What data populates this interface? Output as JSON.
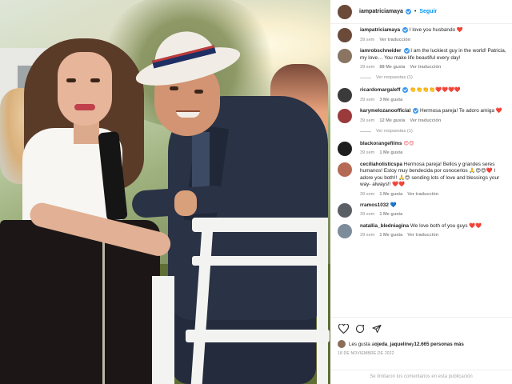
{
  "post": {
    "author": "iampatriciamaya",
    "follow_label": "Seguir",
    "separator": "•",
    "photo_alt": "couple at outdoor event"
  },
  "comments": [
    {
      "user": "iampatriciamaya",
      "verified": true,
      "avatar_color": "#6b4a3a",
      "text": "I love you husbando",
      "heart": "❤️",
      "time": "39 sem",
      "likes": "",
      "translate": "Ver traducción",
      "replies": ""
    },
    {
      "user": "iamrobschneider",
      "verified": true,
      "avatar_color": "#8a7563",
      "text": "I am the luckiest guy in the world! Patricia, my love… You make life beautiful every day!",
      "heart": "",
      "time": "39 sem",
      "likes": "88 Me gusta",
      "translate": "Ver traducción",
      "replies": "Ver respuestas (1)"
    },
    {
      "user": "ricardomargaleff",
      "verified": true,
      "avatar_color": "#3a3a3a",
      "text": "",
      "emojis": "👏👏👏👏❤️❤️❤️❤️",
      "time": "39 sem",
      "likes": "3 Me gusta",
      "translate": "",
      "replies": ""
    },
    {
      "user": "karymelozanoofficial",
      "verified": true,
      "avatar_color": "#9b3a3a",
      "text": "Hermosa pareja! Te adoro amiga",
      "heart": "❤️",
      "time": "39 sem",
      "likes": "12 Me gusta",
      "translate": "Ver traducción",
      "replies": "Ver respuestas (1)"
    },
    {
      "user": "blackorangefilms",
      "verified": false,
      "avatar_color": "#1e1e1e",
      "text": "",
      "emojis": "😍😍",
      "time": "39 sem",
      "likes": "1 Me gusta",
      "translate": "",
      "replies": ""
    },
    {
      "user": "ceciliaholisticspa",
      "verified": false,
      "avatar_color": "#b56a56",
      "text": "Hermosa pareja! Bellos y grandes seres humanos! Estoy muy bendecida por conocerlos 🙏😍😍❤️ I adore you both!! 🙏😍 sending lots of love and blessings your way- always!! ❤️❤️",
      "heart": "",
      "time": "39 sem",
      "likes": "1 Me gusta",
      "translate": "Ver traducción",
      "replies": ""
    },
    {
      "user": "rramos1032",
      "verified": false,
      "avatar_color": "#5a5f66",
      "text": "",
      "emojis": "💙",
      "time": "39 sem",
      "likes": "1 Me gusta",
      "translate": "",
      "replies": ""
    },
    {
      "user": "natallia_bledniagina",
      "verified": false,
      "avatar_color": "#7d8c9a",
      "text": "We love both of you guys",
      "heart": "❤️❤️",
      "time": "39 sem",
      "likes": "1 Me gusta",
      "translate": "Ver traducción",
      "replies": ""
    }
  ],
  "actions": {
    "like_icon": "heart-outline-icon",
    "comment_icon": "comment-icon",
    "share_icon": "paper-plane-icon"
  },
  "likes": {
    "prefix": "Les gusta a ",
    "user": "ojeda_jaqueline",
    "middle": " y ",
    "count": "12.665 personas más"
  },
  "date": "18 DE NOVIEMBRE DE 2022",
  "comments_disabled": "Se limitaron los comentarios en esta publicación",
  "colors": {
    "verified": "#3897f0",
    "follow": "#0095f6",
    "heart": "#ed4956",
    "meta": "#8e8e8e"
  }
}
